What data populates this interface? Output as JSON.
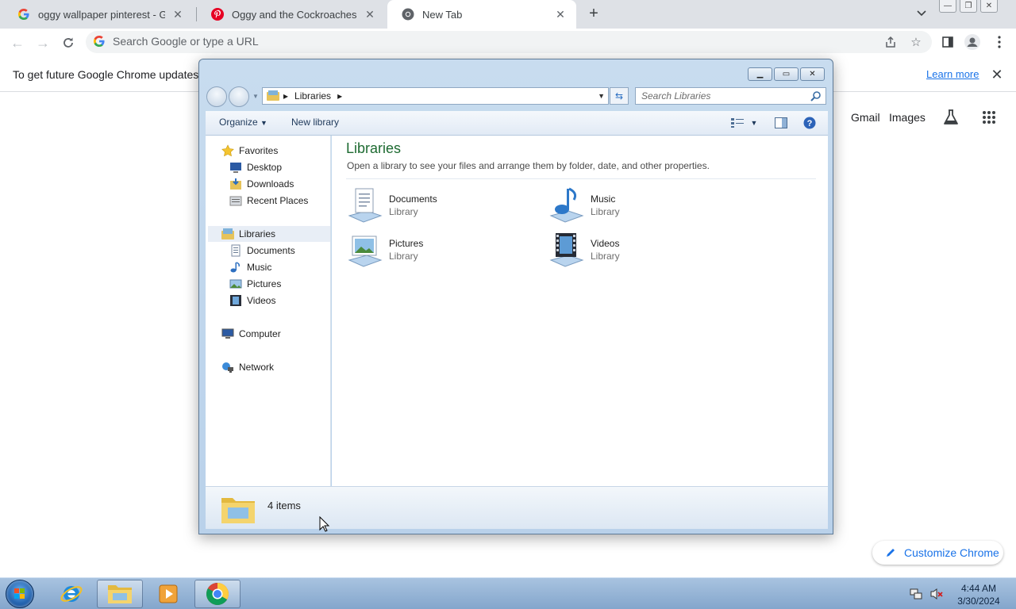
{
  "chrome": {
    "tabs": [
      {
        "title": "oggy wallpaper pinterest - Goog",
        "favicon": "google-g-icon",
        "active": false
      },
      {
        "title": "Oggy and the Cockroaches: one",
        "favicon": "pinterest-icon",
        "active": false
      },
      {
        "title": "New Tab",
        "favicon": "chrome-icon",
        "active": true
      }
    ],
    "omnibox_placeholder": "Search Google or type a URL",
    "infobar": {
      "message": "To get future Google Chrome updates, yo",
      "link": "Learn more"
    },
    "ntp": {
      "gmail": "Gmail",
      "images": "Images",
      "customize": "Customize Chrome"
    }
  },
  "explorer": {
    "breadcrumb": "Libraries",
    "search_placeholder": "Search Libraries",
    "commands": {
      "organize": "Organize",
      "new_library": "New library"
    },
    "nav": {
      "favorites": "Favorites",
      "favorites_items": [
        "Desktop",
        "Downloads",
        "Recent Places"
      ],
      "libraries": "Libraries",
      "libraries_items": [
        "Documents",
        "Music",
        "Pictures",
        "Videos"
      ],
      "computer": "Computer",
      "network": "Network"
    },
    "content": {
      "title": "Libraries",
      "description": "Open a library to see your files and arrange them by folder, date, and other properties.",
      "items": [
        {
          "name": "Documents",
          "type": "Library",
          "icon": "documents-library-icon"
        },
        {
          "name": "Music",
          "type": "Library",
          "icon": "music-library-icon"
        },
        {
          "name": "Pictures",
          "type": "Library",
          "icon": "pictures-library-icon"
        },
        {
          "name": "Videos",
          "type": "Library",
          "icon": "videos-library-icon"
        }
      ]
    },
    "details": {
      "count": "4 items"
    }
  },
  "taskbar": {
    "time": "4:44 AM",
    "date": "3/30/2024"
  },
  "colors": {
    "chrome_link": "#1a73e8",
    "library_title": "#1e6b32",
    "taskbar": "#9bbbdd"
  }
}
